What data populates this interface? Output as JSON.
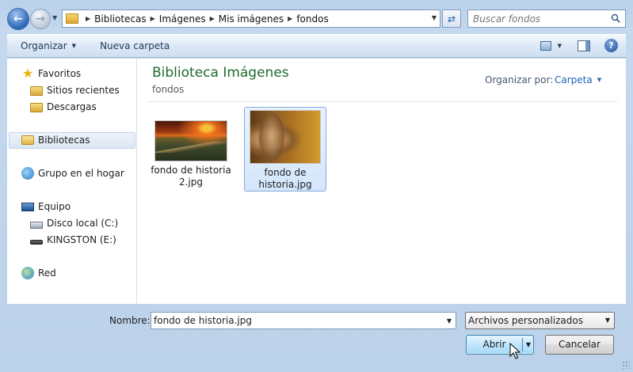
{
  "address_bar": {
    "crumbs": [
      "Bibliotecas",
      "Imágenes",
      "Mis imágenes",
      "fondos"
    ]
  },
  "search": {
    "placeholder": "Buscar fondos"
  },
  "toolbar": {
    "organize_label": "Organizar",
    "new_folder_label": "Nueva carpeta"
  },
  "nav": {
    "favorites": "Favoritos",
    "recent": "Sitios recientes",
    "downloads": "Descargas",
    "libraries": "Bibliotecas",
    "homegroup": "Grupo en el hogar",
    "computer": "Equipo",
    "local_disk": "Disco local (C:)",
    "usb": "KINGSTON (E:)",
    "network": "Red"
  },
  "content": {
    "title": "Biblioteca Imágenes",
    "subtitle": "fondos",
    "arrange_label": "Organizar por:",
    "arrange_value": "Carpeta",
    "files": [
      {
        "line1": "fondo de historia",
        "line2": "2.jpg"
      },
      {
        "line1": "fondo de",
        "line2": "historia.jpg"
      }
    ]
  },
  "bottom": {
    "name_label": "Nombre:",
    "name_value": "fondo de historia.jpg",
    "filter_value": "Archivos personalizados",
    "open_label": "Abrir",
    "cancel_label": "Cancelar"
  },
  "colors": {
    "title_green": "#1d6b2e",
    "link_blue": "#1f63b5"
  }
}
